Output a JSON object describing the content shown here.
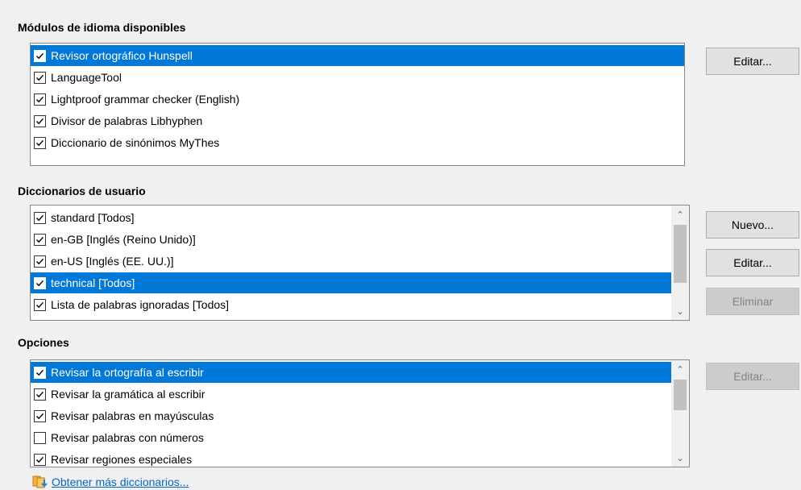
{
  "modules": {
    "title": "Módulos de idioma disponibles",
    "edit_button": "Editar...",
    "items": [
      {
        "label": "Revisor ortográfico Hunspell",
        "checked": true,
        "selected": true
      },
      {
        "label": "LanguageTool",
        "checked": true,
        "selected": false
      },
      {
        "label": "Lightproof grammar checker (English)",
        "checked": true,
        "selected": false
      },
      {
        "label": "Divisor de palabras Libhyphen",
        "checked": true,
        "selected": false
      },
      {
        "label": "Diccionario de sinónimos MyThes",
        "checked": true,
        "selected": false
      }
    ]
  },
  "dictionaries": {
    "title": "Diccionarios de usuario",
    "new_button": "Nuevo...",
    "edit_button": "Editar...",
    "delete_button": "Eliminar",
    "items": [
      {
        "label": "standard [Todos]",
        "checked": true,
        "selected": false
      },
      {
        "label": "en-GB [Inglés (Reino Unido)]",
        "checked": true,
        "selected": false
      },
      {
        "label": "en-US [Inglés (EE. UU.)]",
        "checked": true,
        "selected": false
      },
      {
        "label": "technical [Todos]",
        "checked": true,
        "selected": true
      },
      {
        "label": "Lista de palabras ignoradas [Todos]",
        "checked": true,
        "selected": false
      }
    ]
  },
  "options": {
    "title": "Opciones",
    "edit_button": "Editar...",
    "items": [
      {
        "label": "Revisar la ortografía al escribir",
        "checked": true,
        "selected": true
      },
      {
        "label": "Revisar la gramática al escribir",
        "checked": true,
        "selected": false
      },
      {
        "label": "Revisar palabras en mayúsculas",
        "checked": true,
        "selected": false
      },
      {
        "label": "Revisar palabras con números",
        "checked": false,
        "selected": false
      },
      {
        "label": "Revisar regiones especiales",
        "checked": true,
        "selected": false
      }
    ]
  },
  "more_dictionaries_link": "Obtener más diccionarios..."
}
